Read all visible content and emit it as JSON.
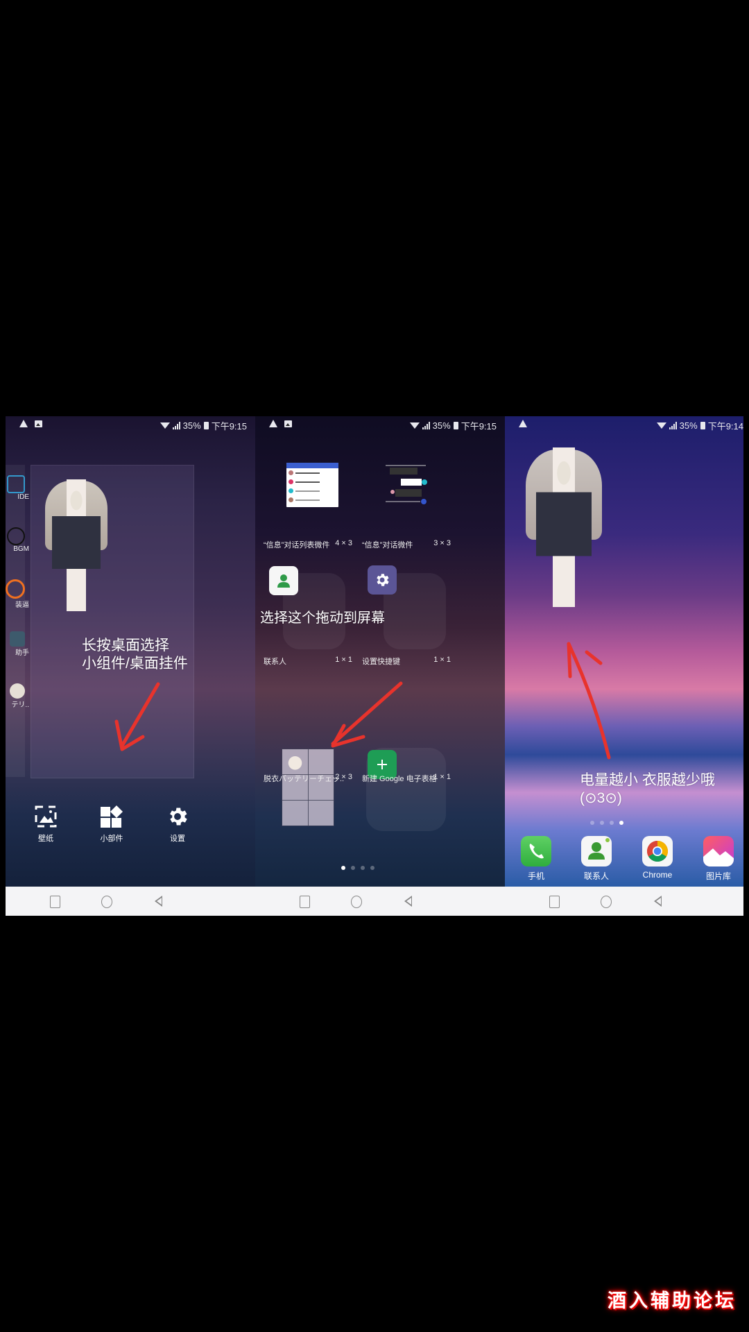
{
  "status_bar": {
    "battery_percent": "35%",
    "panels": [
      {
        "time": "下午9:15",
        "notif_icons": [
          "warning-icon",
          "image-icon"
        ]
      },
      {
        "time": "下午9:15",
        "notif_icons": [
          "warning-icon",
          "image-icon"
        ]
      },
      {
        "time": "下午9:14",
        "notif_icons": [
          "warning-icon"
        ]
      }
    ]
  },
  "panel1": {
    "edge_apps": [
      "IDE",
      "BGM",
      "装逼",
      "助手",
      "テリ.."
    ],
    "annotation_lines": [
      "长按桌面选择",
      "小组件/桌面挂件"
    ],
    "menu": [
      {
        "label": "壁纸",
        "icon": "wallpaper-icon"
      },
      {
        "label": "小部件",
        "icon": "widgets-icon"
      },
      {
        "label": "设置",
        "icon": "settings-gear-icon"
      }
    ]
  },
  "panel2": {
    "annotation": "选择这个拖动到屏幕",
    "widgets": [
      {
        "name": "“信息”对话列表微件",
        "size": "4 × 3"
      },
      {
        "name": "“信息”对话微件",
        "size": "3 × 3"
      },
      {
        "name": "联系人",
        "size": "1 × 1"
      },
      {
        "name": "设置快捷键",
        "size": "1 × 1"
      },
      {
        "name": "脱衣バッテリーチェッ..",
        "size": "2 × 3"
      },
      {
        "name": "新建 Google 电子表格",
        "size": "1 × 1"
      }
    ],
    "page_count": 4,
    "active_page": 1
  },
  "panel3": {
    "annotation_lines": [
      "电量越小 衣服越少哦",
      "(⊙3⊙)"
    ],
    "page_count": 4,
    "active_page": 4,
    "dock": [
      {
        "label": "手机",
        "icon": "phone-icon"
      },
      {
        "label": "联系人",
        "icon": "contacts-icon"
      },
      {
        "label": "Chrome",
        "icon": "chrome-icon"
      },
      {
        "label": "图片库",
        "icon": "gallery-icon"
      }
    ]
  },
  "colors": {
    "annotation_red": "#e8332c",
    "sheets_green": "#1e9d55",
    "settings_purple": "#5b5596"
  },
  "watermark": "酒入辅助论坛"
}
